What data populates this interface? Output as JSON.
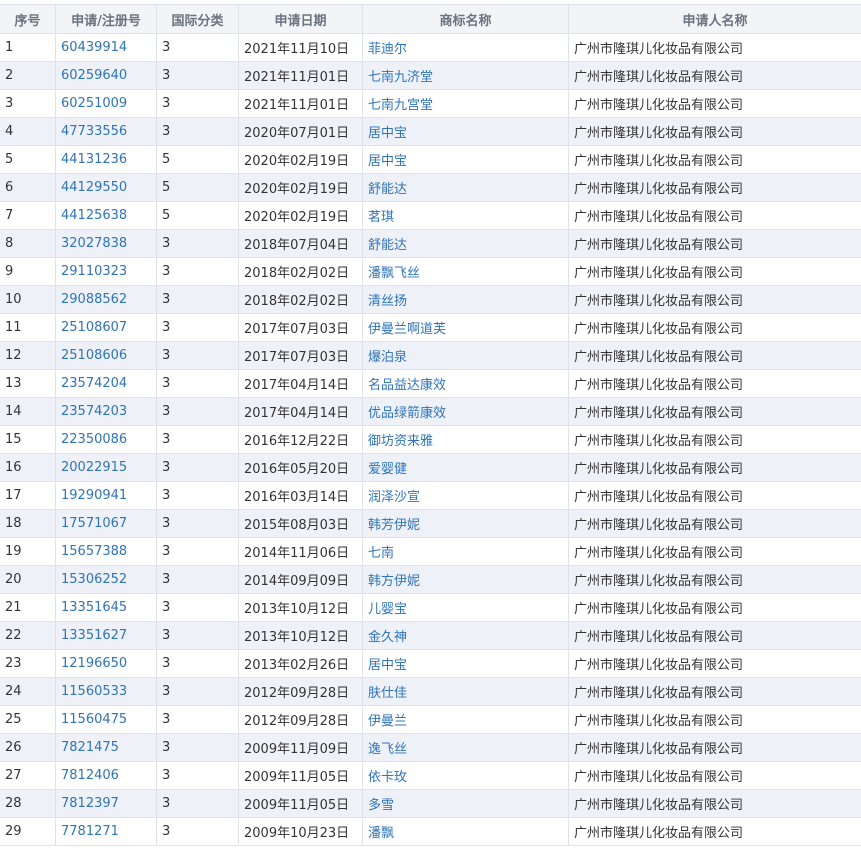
{
  "columns": [
    "序号",
    "申请/注册号",
    "国际分类",
    "申请日期",
    "商标名称",
    "申请人名称"
  ],
  "rows": [
    {
      "index": "1",
      "reg_no": "60439914",
      "class": "3",
      "date": "2021年11月10日",
      "name": "菲迪尔",
      "applicant": "广州市隆琪儿化妆品有限公司"
    },
    {
      "index": "2",
      "reg_no": "60259640",
      "class": "3",
      "date": "2021年11月01日",
      "name": "七南九济堂",
      "applicant": "广州市隆琪儿化妆品有限公司"
    },
    {
      "index": "3",
      "reg_no": "60251009",
      "class": "3",
      "date": "2021年11月01日",
      "name": "七南九宫堂",
      "applicant": "广州市隆琪儿化妆品有限公司"
    },
    {
      "index": "4",
      "reg_no": "47733556",
      "class": "3",
      "date": "2020年07月01日",
      "name": "居中宝",
      "applicant": "广州市隆琪儿化妆品有限公司"
    },
    {
      "index": "5",
      "reg_no": "44131236",
      "class": "5",
      "date": "2020年02月19日",
      "name": "居中宝",
      "applicant": "广州市隆琪儿化妆品有限公司"
    },
    {
      "index": "6",
      "reg_no": "44129550",
      "class": "5",
      "date": "2020年02月19日",
      "name": "舒能达",
      "applicant": "广州市隆琪儿化妆品有限公司"
    },
    {
      "index": "7",
      "reg_no": "44125638",
      "class": "5",
      "date": "2020年02月19日",
      "name": "茗琪",
      "applicant": "广州市隆琪儿化妆品有限公司"
    },
    {
      "index": "8",
      "reg_no": "32027838",
      "class": "3",
      "date": "2018年07月04日",
      "name": "舒能达",
      "applicant": "广州市隆琪儿化妆品有限公司"
    },
    {
      "index": "9",
      "reg_no": "29110323",
      "class": "3",
      "date": "2018年02月02日",
      "name": "潘飘飞丝",
      "applicant": "广州市隆琪儿化妆品有限公司"
    },
    {
      "index": "10",
      "reg_no": "29088562",
      "class": "3",
      "date": "2018年02月02日",
      "name": "清丝扬",
      "applicant": "广州市隆琪儿化妆品有限公司"
    },
    {
      "index": "11",
      "reg_no": "25108607",
      "class": "3",
      "date": "2017年07月03日",
      "name": "伊曼兰啊道芙",
      "applicant": "广州市隆琪儿化妆品有限公司"
    },
    {
      "index": "12",
      "reg_no": "25108606",
      "class": "3",
      "date": "2017年07月03日",
      "name": "爆泊泉",
      "applicant": "广州市隆琪儿化妆品有限公司"
    },
    {
      "index": "13",
      "reg_no": "23574204",
      "class": "3",
      "date": "2017年04月14日",
      "name": "名品益达康效",
      "applicant": "广州市隆琪儿化妆品有限公司"
    },
    {
      "index": "14",
      "reg_no": "23574203",
      "class": "3",
      "date": "2017年04月14日",
      "name": "优品绿箭康效",
      "applicant": "广州市隆琪儿化妆品有限公司"
    },
    {
      "index": "15",
      "reg_no": "22350086",
      "class": "3",
      "date": "2016年12月22日",
      "name": "御坊资来雅",
      "applicant": "广州市隆琪儿化妆品有限公司"
    },
    {
      "index": "16",
      "reg_no": "20022915",
      "class": "3",
      "date": "2016年05月20日",
      "name": "爱婴健",
      "applicant": "广州市隆琪儿化妆品有限公司"
    },
    {
      "index": "17",
      "reg_no": "19290941",
      "class": "3",
      "date": "2016年03月14日",
      "name": "润泽沙宣",
      "applicant": "广州市隆琪儿化妆品有限公司"
    },
    {
      "index": "18",
      "reg_no": "17571067",
      "class": "3",
      "date": "2015年08月03日",
      "name": "韩芳伊妮",
      "applicant": "广州市隆琪儿化妆品有限公司"
    },
    {
      "index": "19",
      "reg_no": "15657388",
      "class": "3",
      "date": "2014年11月06日",
      "name": "七南",
      "applicant": "广州市隆琪儿化妆品有限公司"
    },
    {
      "index": "20",
      "reg_no": "15306252",
      "class": "3",
      "date": "2014年09月09日",
      "name": "韩方伊妮",
      "applicant": "广州市隆琪儿化妆品有限公司"
    },
    {
      "index": "21",
      "reg_no": "13351645",
      "class": "3",
      "date": "2013年10月12日",
      "name": "儿婴宝",
      "applicant": "广州市隆琪儿化妆品有限公司"
    },
    {
      "index": "22",
      "reg_no": "13351627",
      "class": "3",
      "date": "2013年10月12日",
      "name": "金久神",
      "applicant": "广州市隆琪儿化妆品有限公司"
    },
    {
      "index": "23",
      "reg_no": "12196650",
      "class": "3",
      "date": "2013年02月26日",
      "name": "居中宝",
      "applicant": "广州市隆琪儿化妆品有限公司"
    },
    {
      "index": "24",
      "reg_no": "11560533",
      "class": "3",
      "date": "2012年09月28日",
      "name": "肤仕佳",
      "applicant": "广州市隆琪儿化妆品有限公司"
    },
    {
      "index": "25",
      "reg_no": "11560475",
      "class": "3",
      "date": "2012年09月28日",
      "name": "伊曼兰",
      "applicant": "广州市隆琪儿化妆品有限公司"
    },
    {
      "index": "26",
      "reg_no": "7821475",
      "class": "3",
      "date": "2009年11月09日",
      "name": "逸飞丝",
      "applicant": "广州市隆琪儿化妆品有限公司"
    },
    {
      "index": "27",
      "reg_no": "7812406",
      "class": "3",
      "date": "2009年11月05日",
      "name": "依卡玫",
      "applicant": "广州市隆琪儿化妆品有限公司"
    },
    {
      "index": "28",
      "reg_no": "7812397",
      "class": "3",
      "date": "2009年11月05日",
      "name": "多雪",
      "applicant": "广州市隆琪儿化妆品有限公司"
    },
    {
      "index": "29",
      "reg_no": "7781271",
      "class": "3",
      "date": "2009年10月23日",
      "name": "潘飘",
      "applicant": "广州市隆琪儿化妆品有限公司"
    }
  ]
}
